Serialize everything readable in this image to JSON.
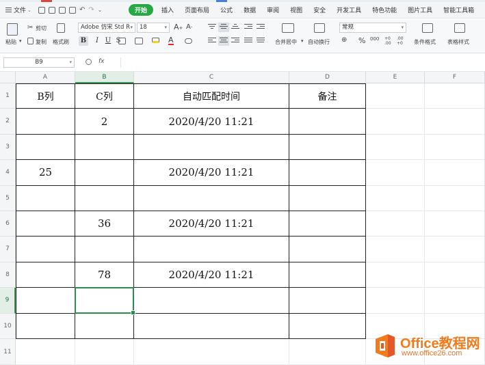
{
  "menubar": {
    "file_label": "文件",
    "tabs": [
      "开始",
      "插入",
      "页面布局",
      "公式",
      "数据",
      "审阅",
      "视图",
      "安全",
      "开发工具",
      "特色功能",
      "图片工具",
      "智能工具箱"
    ],
    "active_tab": "开始"
  },
  "ribbon": {
    "paste_label": "粘贴",
    "cut_label": "剪切",
    "copy_label": "复制",
    "format_painter_label": "格式刷",
    "font_name": "Adobe 仿宋 Std R",
    "font_size": "18",
    "bold": "B",
    "italic": "I",
    "underline": "U",
    "strike": "S",
    "merge_center_label": "合并居中",
    "wrap_text_label": "自动换行",
    "number_format": "常规",
    "percent": "%",
    "thousands": "000",
    "inc_decimal": "+0 .00",
    "dec_decimal": ".00 +0",
    "conditional_format_label": "条件格式",
    "table_style_label": "表格样式",
    "font_grow": "A",
    "font_shrink": "A",
    "font_color_letter": "A"
  },
  "formula_bar": {
    "name_box": "B9",
    "fx_label": "fx",
    "formula": ""
  },
  "grid": {
    "columns": [
      "A",
      "B",
      "C",
      "D",
      "E",
      "F"
    ],
    "selected_column": "B",
    "rows": [
      "1",
      "2",
      "3",
      "4",
      "5",
      "6",
      "7",
      "8",
      "9",
      "10",
      "11"
    ],
    "selected_row": "9",
    "headers": [
      "B列",
      "C列",
      "自动匹配时间",
      "备注"
    ],
    "data": [
      {
        "b": "",
        "c": "2",
        "time": "2020/4/20 11:21",
        "note": ""
      },
      {
        "b": "",
        "c": "",
        "time": "",
        "note": ""
      },
      {
        "b": "25",
        "c": "",
        "time": "2020/4/20 11:21",
        "note": ""
      },
      {
        "b": "",
        "c": "",
        "time": "",
        "note": ""
      },
      {
        "b": "",
        "c": "36",
        "time": "2020/4/20 11:21",
        "note": ""
      },
      {
        "b": "",
        "c": "",
        "time": "",
        "note": ""
      },
      {
        "b": "",
        "c": "78",
        "time": "2020/4/20 11:21",
        "note": ""
      },
      {
        "b": "",
        "c": "",
        "time": "",
        "note": ""
      },
      {
        "b": "",
        "c": "",
        "time": "",
        "note": ""
      }
    ]
  },
  "watermark": {
    "title": "Office教程网",
    "url": "www.office26.com",
    "colors": {
      "orange": "#f07c1e",
      "red": "#d9452b"
    }
  },
  "colors": {
    "accent_green": "#28a745",
    "selection_green": "#2e8b4e"
  }
}
